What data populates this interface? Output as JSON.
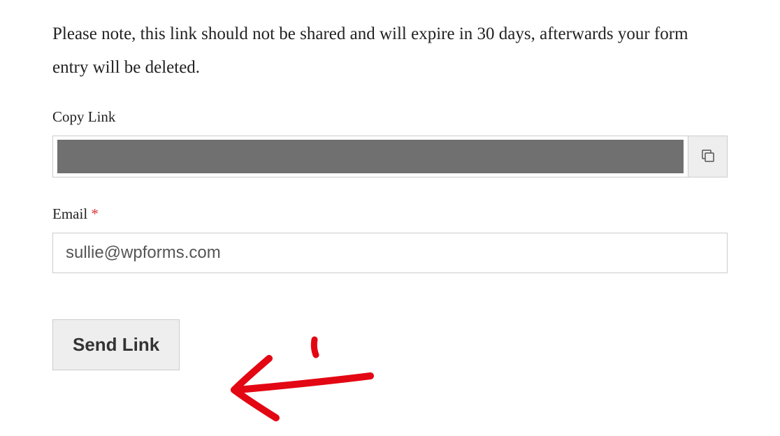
{
  "notice": "Please note, this link should not be shared and will expire in 30 days, afterwards your form entry will be deleted.",
  "copyLink": {
    "label": "Copy Link"
  },
  "email": {
    "label": "Email",
    "required": "*",
    "value": "sullie@wpforms.com"
  },
  "sendButton": {
    "label": "Send Link"
  }
}
